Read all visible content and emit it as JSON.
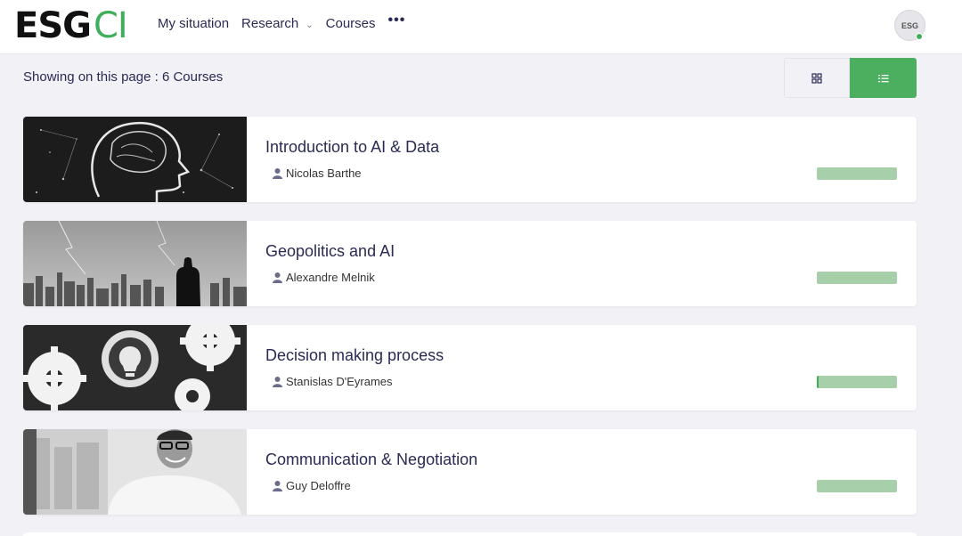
{
  "header": {
    "logo_main": "ESG",
    "logo_accent": "CI",
    "nav": [
      {
        "label": "My situation"
      },
      {
        "label": "Research",
        "has_dropdown": true
      },
      {
        "label": "Courses"
      }
    ],
    "more_label": "•••",
    "avatar_text": "ESG"
  },
  "listing": {
    "count_text": "Showing on this page : 6 Courses",
    "view_mode": "list"
  },
  "courses": [
    {
      "title": "Introduction to AI & Data",
      "author": "Nicolas Barthe",
      "progress": 0
    },
    {
      "title": "Geopolitics and AI",
      "author": "Alexandre Melnik",
      "progress": 0
    },
    {
      "title": "Decision making process",
      "author": "Stanislas D'Eyrames",
      "progress": 0.02
    },
    {
      "title": "Communication & Negotiation",
      "author": "Guy Deloffre",
      "progress": 0
    }
  ],
  "colors": {
    "accent": "#4caf5f",
    "progress_track": "#a6cfaa",
    "text": "#2a2a55",
    "background": "#f2f2f6"
  }
}
